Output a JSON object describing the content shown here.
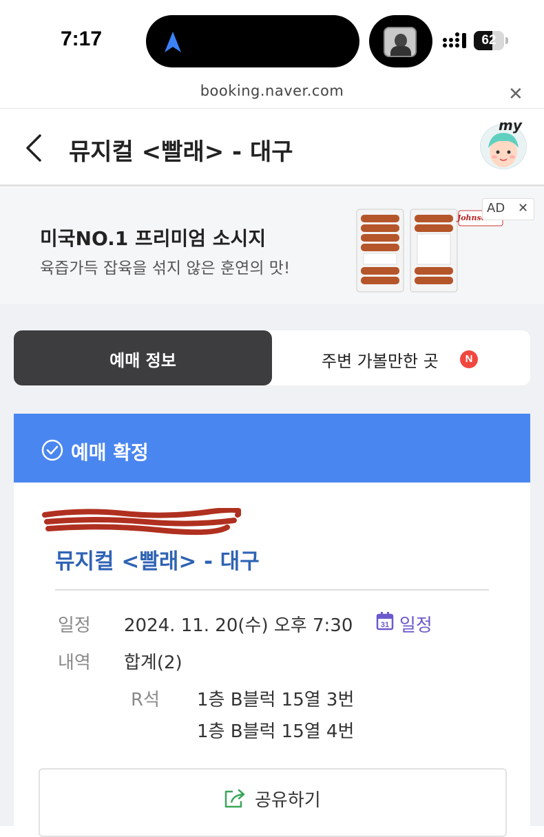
{
  "status_bar": {
    "time": "7:17",
    "battery": "62",
    "battery_level": 0.62
  },
  "browser": {
    "url": "booking.naver.com",
    "close_icon": "close-icon"
  },
  "header": {
    "title": "뮤지컬 <빨래> - 대구",
    "avatar_label": "my"
  },
  "ad": {
    "title": "미국NO.1 프리미엄 소시지",
    "subtitle": "육즙가득 잡육을 섞지 않은 훈연의 맛!",
    "brand": "Johnsonville",
    "badge": "AD",
    "close": "✕"
  },
  "tabs": [
    {
      "label": "예매 정보",
      "active": true
    },
    {
      "label": "주변 가볼만한 곳",
      "badge": "N"
    }
  ],
  "booking": {
    "status": "예매 확정",
    "title": "뮤지컬 <빨래> - 대구",
    "schedule_label": "일정",
    "schedule_value": "2024. 11. 20(수) 오후 7:30",
    "calendar_icon_day": "31",
    "calendar_link": "일정",
    "details_label": "내역",
    "details_value": "합계(2)",
    "seat_grade": "R석",
    "seats": [
      "1층 B블럭 15열 3번",
      "1층 B블럭 15열 4번"
    ],
    "share_label": "공유하기"
  },
  "colors": {
    "accent_blue": "#4a86f0",
    "title_blue": "#2f63b4",
    "dark_tab": "#3d3d40",
    "badge_red": "#f0473f",
    "link_purple": "#6a5acd"
  }
}
